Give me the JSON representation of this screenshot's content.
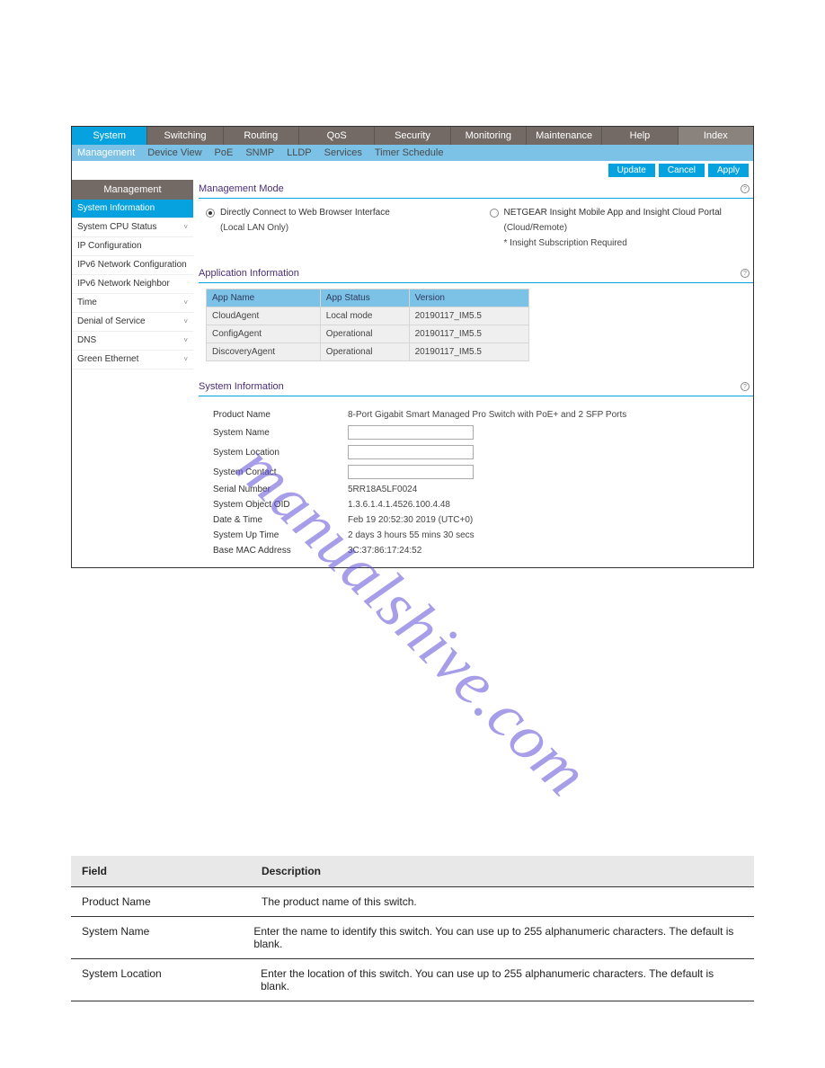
{
  "top_tabs": [
    "System",
    "Switching",
    "Routing",
    "QoS",
    "Security",
    "Monitoring",
    "Maintenance",
    "Help",
    "Index"
  ],
  "top_active": 0,
  "sub_tabs": [
    "Management",
    "Device View",
    "PoE",
    "SNMP",
    "LLDP",
    "Services",
    "Timer Schedule"
  ],
  "sub_active": 0,
  "actions": {
    "update": "Update",
    "cancel": "Cancel",
    "apply": "Apply"
  },
  "sidebar": {
    "heading": "Management",
    "items": [
      {
        "label": "System Information",
        "expandable": false,
        "active": true
      },
      {
        "label": "System CPU Status",
        "expandable": true
      },
      {
        "label": "IP Configuration",
        "expandable": false
      },
      {
        "label": "IPv6 Network Configuration",
        "expandable": false
      },
      {
        "label": "IPv6 Network Neighbor",
        "expandable": false
      },
      {
        "label": "Time",
        "expandable": true
      },
      {
        "label": "Denial of Service",
        "expandable": true
      },
      {
        "label": "DNS",
        "expandable": true
      },
      {
        "label": "Green Ethernet",
        "expandable": true
      }
    ]
  },
  "sections": {
    "mgmt_mode": {
      "title": "Management Mode",
      "opt1": {
        "label": "Directly Connect to Web Browser Interface",
        "sub": "(Local LAN Only)",
        "selected": true
      },
      "opt2": {
        "label": "NETGEAR Insight Mobile App and Insight Cloud Portal",
        "sub1": "(Cloud/Remote)",
        "sub2": "* Insight Subscription Required",
        "selected": false
      }
    },
    "app_info": {
      "title": "Application Information",
      "headers": [
        "App Name",
        "App Status",
        "Version"
      ],
      "rows": [
        [
          "CloudAgent",
          "Local mode",
          "20190117_IM5.5"
        ],
        [
          "ConfigAgent",
          "Operational",
          "20190117_IM5.5"
        ],
        [
          "DiscoveryAgent",
          "Operational",
          "20190117_IM5.5"
        ]
      ]
    },
    "sys_info": {
      "title": "System Information",
      "fields": {
        "product_name": {
          "label": "Product Name",
          "value": "8-Port Gigabit Smart Managed Pro Switch with PoE+ and 2 SFP Ports"
        },
        "system_name": {
          "label": "System Name",
          "input": ""
        },
        "system_location": {
          "label": "System Location",
          "input": ""
        },
        "system_contact": {
          "label": "System Contact",
          "input": ""
        },
        "serial": {
          "label": "Serial Number",
          "value": "5RR18A5LF0024"
        },
        "oid": {
          "label": "System Object OID",
          "value": "1.3.6.1.4.1.4526.100.4.48"
        },
        "datetime": {
          "label": "Date & Time",
          "value": "Feb 19 20:52:30 2019 (UTC+0)"
        },
        "uptime": {
          "label": "System Up Time",
          "value": "2 days 3 hours 55 mins 30 secs"
        },
        "mac": {
          "label": "Base MAC Address",
          "value": "3C:37:86:17:24:52"
        }
      }
    }
  },
  "watermark": "manualshive.com",
  "doc_table": {
    "head": {
      "c1": "Field",
      "c2": "Description"
    },
    "rows": [
      {
        "c1": "Product Name",
        "c2": "The product name of this switch."
      },
      {
        "c1": "System Name",
        "c2": "Enter the name to identify this switch. You can use up to 255 alphanumeric characters. The default is blank."
      },
      {
        "c1": "System Location",
        "c2": "Enter the location of this switch. You can use up to 255 alphanumeric characters. The default is blank."
      }
    ]
  }
}
